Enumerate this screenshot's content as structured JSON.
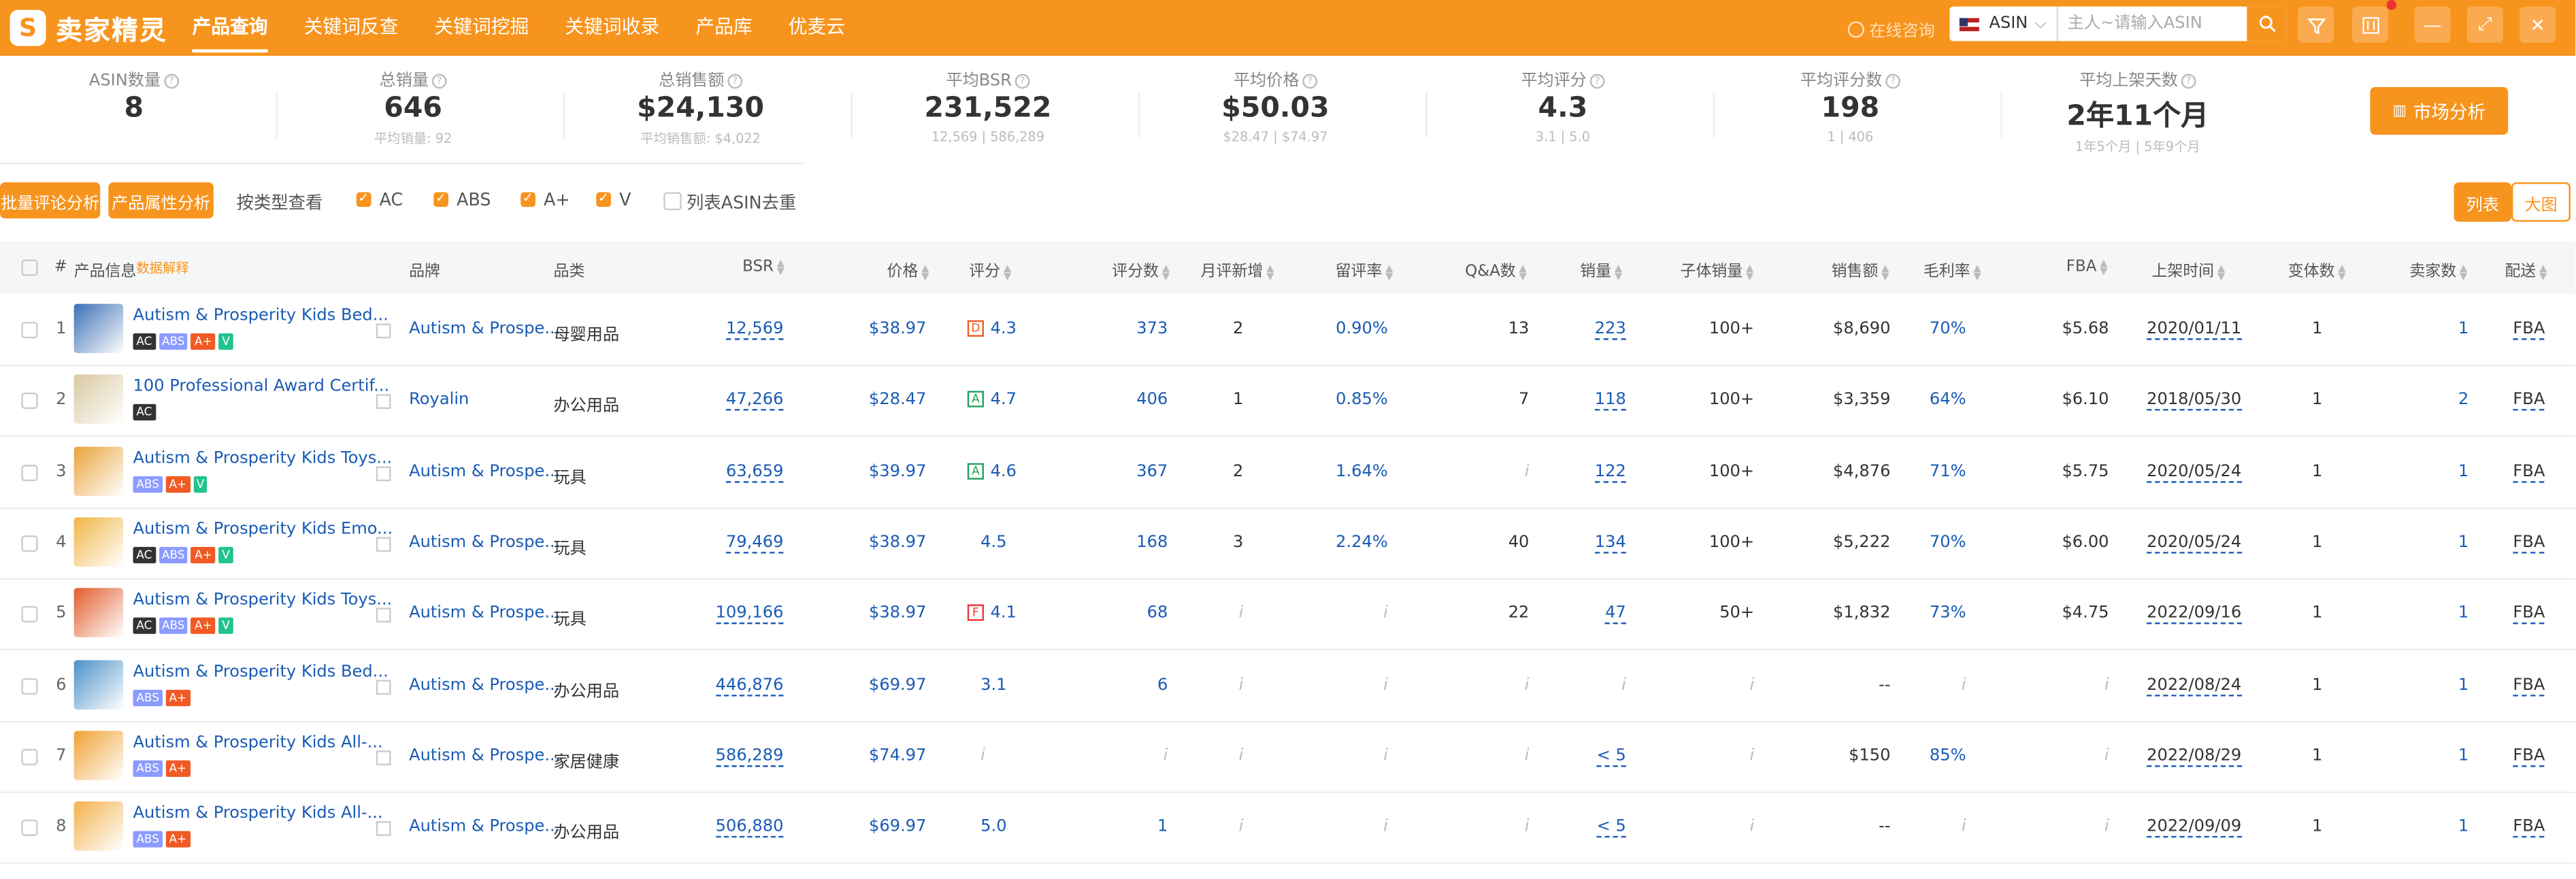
{
  "app": {
    "name": "卖家精灵",
    "logo_letter": "S"
  },
  "nav": [
    "产品查询",
    "关键词反查",
    "关键词挖掘",
    "关键词收录",
    "产品库",
    "优麦云"
  ],
  "consult": "在线咨询",
  "search": {
    "marketplace": "ASIN",
    "placeholder": "主人~请输入ASIN"
  },
  "stats": [
    {
      "label": "ASIN数量",
      "value": "8",
      "sub": ""
    },
    {
      "label": "总销量",
      "value": "646",
      "sub": "平均销量: 92"
    },
    {
      "label": "总销售额",
      "value": "$24,130",
      "sub": "平均销售额: $4,022"
    },
    {
      "label": "平均BSR",
      "value": "231,522",
      "sub": "12,569 | 586,289"
    },
    {
      "label": "平均价格",
      "value": "$50.03",
      "sub": "$28.47 | $74.97"
    },
    {
      "label": "平均评分",
      "value": "4.3",
      "sub": "3.1 | 5.0"
    },
    {
      "label": "平均评分数",
      "value": "198",
      "sub": "1 | 406"
    },
    {
      "label": "平均上架天数",
      "value": "2年11个月",
      "sub": "1年5个月 | 5年9个月"
    }
  ],
  "market_button": "市场分析",
  "filters": {
    "batch_review": "批量评论分析",
    "attr_analysis": "产品属性分析",
    "view_by_type": "按类型查看",
    "checks": [
      {
        "label": "AC",
        "checked": true
      },
      {
        "label": "ABS",
        "checked": true
      },
      {
        "label": "A+",
        "checked": true
      },
      {
        "label": "V",
        "checked": true
      },
      {
        "label": "列表ASIN去重",
        "checked": false
      }
    ],
    "view_list": "列表",
    "view_grid": "大图"
  },
  "columns": {
    "index": "#",
    "product": "产品信息",
    "explain": "数据解释",
    "brand": "品牌",
    "category": "品类",
    "bsr": "BSR",
    "price": "价格",
    "rating": "评分",
    "reviews": "评分数",
    "monthly_new": "月评新增",
    "retention": "留评率",
    "qa": "Q&A数",
    "sales": "销量",
    "variant_sales": "子体销量",
    "revenue": "销售额",
    "margin": "毛利率",
    "fba": "FBA",
    "listed": "上架时间",
    "variants": "变体数",
    "sellers": "卖家数",
    "ship": "配送"
  },
  "rows": [
    {
      "idx": "1",
      "title": "Autism & Prosperity Kids Bed...",
      "tags": [
        "AC",
        "ABS",
        "A+",
        "V"
      ],
      "brand": "Autism & Prospe...",
      "category": "母婴用品",
      "bsr": "12,569",
      "price": "$38.97",
      "grade": "D",
      "grade_color": "#f15a24",
      "rating": "4.3",
      "reviews": "373",
      "monthly_new": "2",
      "retention": "0.90%",
      "qa": "13",
      "sales": "223",
      "variant_sales": "100+",
      "revenue": "$8,690",
      "margin": "70%",
      "fba": "$5.68",
      "listed": "2020/01/11",
      "variants": "1",
      "sellers": "1",
      "ship": "FBA",
      "thumb": "#3a6fb5"
    },
    {
      "idx": "2",
      "title": "100 Professional Award Certif...",
      "tags": [
        "AC"
      ],
      "brand": "Royalin",
      "category": "办公用品",
      "bsr": "47,266",
      "price": "$28.47",
      "grade": "A",
      "grade_color": "#22a060",
      "rating": "4.7",
      "reviews": "406",
      "monthly_new": "1",
      "retention": "0.85%",
      "qa": "7",
      "sales": "118",
      "variant_sales": "100+",
      "revenue": "$3,359",
      "margin": "64%",
      "fba": "$6.10",
      "listed": "2018/05/30",
      "variants": "1",
      "sellers": "2",
      "ship": "FBA",
      "thumb": "#d9c9a0"
    },
    {
      "idx": "3",
      "title": "Autism & Prosperity Kids Toys...",
      "tags": [
        "ABS",
        "A+",
        "V"
      ],
      "brand": "Autism & Prospe...",
      "category": "玩具",
      "bsr": "63,659",
      "price": "$39.97",
      "grade": "A",
      "grade_color": "#22a060",
      "rating": "4.6",
      "reviews": "367",
      "monthly_new": "2",
      "retention": "1.64%",
      "qa": "i",
      "sales": "122",
      "variant_sales": "100+",
      "revenue": "$4,876",
      "margin": "71%",
      "fba": "$5.75",
      "listed": "2020/05/24",
      "variants": "1",
      "sellers": "1",
      "ship": "FBA",
      "thumb": "#e8a33a"
    },
    {
      "idx": "4",
      "title": "Autism & Prosperity Kids Emo...",
      "tags": [
        "AC",
        "ABS",
        "A+",
        "V"
      ],
      "brand": "Autism & Prospe...",
      "category": "玩具",
      "bsr": "79,469",
      "price": "$38.97",
      "grade": "",
      "grade_color": "",
      "rating": "4.5",
      "reviews": "168",
      "monthly_new": "3",
      "retention": "2.24%",
      "qa": "40",
      "sales": "134",
      "variant_sales": "100+",
      "revenue": "$5,222",
      "margin": "70%",
      "fba": "$6.00",
      "listed": "2020/05/24",
      "variants": "1",
      "sellers": "1",
      "ship": "FBA",
      "thumb": "#f0b545"
    },
    {
      "idx": "5",
      "title": "Autism & Prosperity Kids Toys...",
      "tags": [
        "AC",
        "ABS",
        "A+",
        "V"
      ],
      "brand": "Autism & Prospe...",
      "category": "玩具",
      "bsr": "109,166",
      "price": "$38.97",
      "grade": "F",
      "grade_color": "#e33",
      "rating": "4.1",
      "reviews": "68",
      "monthly_new": "i",
      "retention": "i",
      "qa": "22",
      "sales": "47",
      "variant_sales": "50+",
      "revenue": "$1,832",
      "margin": "73%",
      "fba": "$4.75",
      "listed": "2022/09/16",
      "variants": "1",
      "sellers": "1",
      "ship": "FBA",
      "thumb": "#e25b2a"
    },
    {
      "idx": "6",
      "title": "Autism & Prosperity Kids Bed...",
      "tags": [
        "ABS",
        "A+"
      ],
      "brand": "Autism & Prospe...",
      "category": "办公用品",
      "bsr": "446,876",
      "price": "$69.97",
      "grade": "",
      "grade_color": "",
      "rating": "3.1",
      "reviews": "6",
      "monthly_new": "i",
      "retention": "i",
      "qa": "i",
      "sales": "i",
      "variant_sales": "i",
      "revenue": "--",
      "margin": "i",
      "fba": "i",
      "listed": "2022/08/24",
      "variants": "1",
      "sellers": "1",
      "ship": "FBA",
      "thumb": "#4a90c8"
    },
    {
      "idx": "7",
      "title": "Autism & Prosperity Kids All-...",
      "tags": [
        "ABS",
        "A+"
      ],
      "brand": "Autism & Prospe...",
      "category": "家居健康",
      "bsr": "586,289",
      "price": "$74.97",
      "grade": "",
      "grade_color": "",
      "rating": "i",
      "reviews": "i",
      "monthly_new": "i",
      "retention": "i",
      "qa": "i",
      "sales": "< 5",
      "variant_sales": "i",
      "revenue": "$150",
      "margin": "85%",
      "fba": "i",
      "listed": "2022/08/29",
      "variants": "1",
      "sellers": "1",
      "ship": "FBA",
      "thumb": "#f0a030"
    },
    {
      "idx": "8",
      "title": "Autism & Prosperity Kids All-...",
      "tags": [
        "ABS",
        "A+"
      ],
      "brand": "Autism & Prospe...",
      "category": "办公用品",
      "bsr": "506,880",
      "price": "$69.97",
      "grade": "",
      "grade_color": "",
      "rating": "5.0",
      "reviews": "1",
      "monthly_new": "i",
      "retention": "i",
      "qa": "i",
      "sales": "< 5",
      "variant_sales": "i",
      "revenue": "--",
      "margin": "i",
      "fba": "i",
      "listed": "2022/09/09",
      "variants": "1",
      "sellers": "1",
      "ship": "FBA",
      "thumb": "#f2b24a"
    }
  ],
  "colors": {
    "brand": "#f7941d",
    "link": "#1a5bb5"
  }
}
